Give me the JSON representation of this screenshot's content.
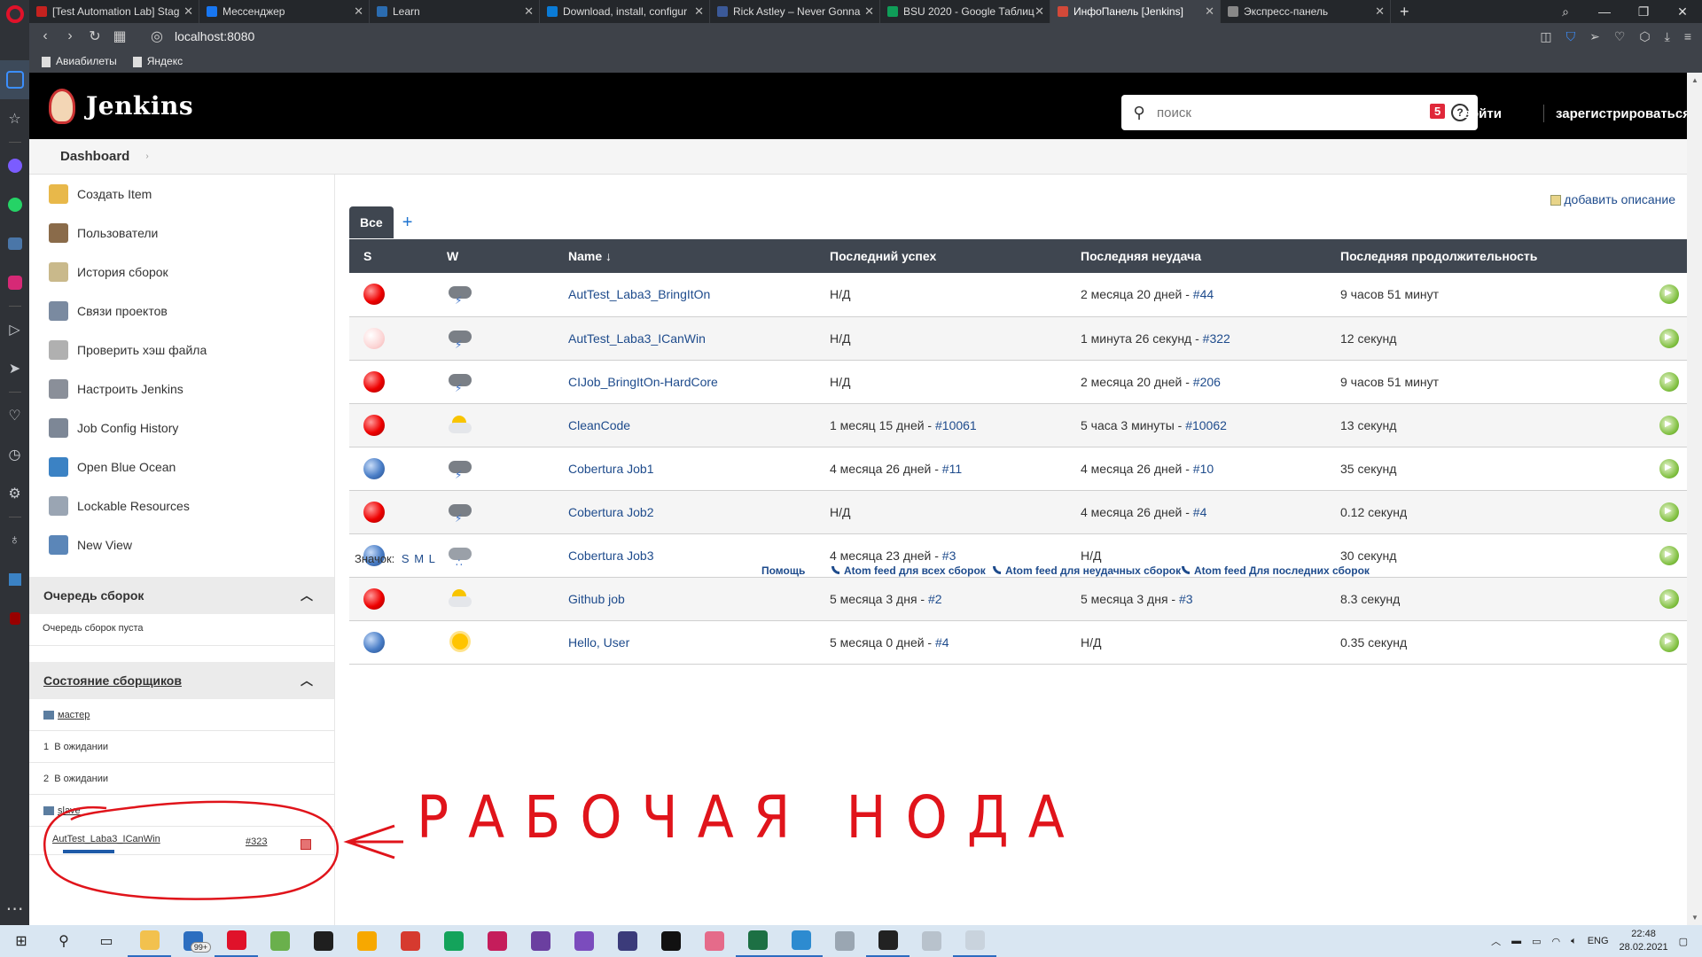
{
  "browser": {
    "tabs": [
      {
        "title": "[Test Automation Lab] Stag",
        "color": "#c5221f"
      },
      {
        "title": "Мессенджер",
        "color": "#1877f2"
      },
      {
        "title": "Learn",
        "color": "#2b6cb0"
      },
      {
        "title": "Download, install, configur",
        "color": "#0a7bd6"
      },
      {
        "title": "Rick Astley – Never Gonna",
        "color": "#3b5998"
      },
      {
        "title": "BSU 2020 - Google Таблиц",
        "color": "#0f9d58"
      },
      {
        "title": "ИнфоПанель [Jenkins]",
        "color": "#d24939"
      },
      {
        "title": "Экспресс-панель",
        "color": "#888888"
      }
    ],
    "active_tab": 6,
    "url": "localhost:8080",
    "bookmarks": [
      "Авиабилеты",
      "Яндекс"
    ]
  },
  "header": {
    "title": "Jenkins",
    "search_placeholder": "поиск",
    "notifications": "5",
    "login": "войти",
    "register": "зарегистрироваться"
  },
  "breadcrumb": {
    "root": "Dashboard"
  },
  "tasks": [
    {
      "label": "Создать Item",
      "icon": "new-item-icon",
      "color": "#e8b84a"
    },
    {
      "label": "Пользователи",
      "icon": "users-icon",
      "color": "#8a6b4a"
    },
    {
      "label": "История сборок",
      "icon": "notepad-icon",
      "color": "#c9b98b"
    },
    {
      "label": "Связи проектов",
      "icon": "search-icon",
      "color": "#7a8aa0"
    },
    {
      "label": "Проверить хэш файла",
      "icon": "fingerprint-icon",
      "color": "#b0b0b0"
    },
    {
      "label": "Настроить Jenkins",
      "icon": "gear-icon",
      "color": "#8a8f99"
    },
    {
      "label": "Job Config History",
      "icon": "tools-icon",
      "color": "#7d8796"
    },
    {
      "label": "Open Blue Ocean",
      "icon": "blue-ocean-icon",
      "color": "#3b82c4"
    },
    {
      "label": "Lockable Resources",
      "icon": "lock-icon",
      "color": "#9aa5b3"
    },
    {
      "label": "New View",
      "icon": "folder-icon",
      "color": "#5b86b8"
    }
  ],
  "build_queue": {
    "title": "Очередь сборок",
    "empty_text": "Очередь сборок пуста"
  },
  "executors": {
    "title": "Состояние сборщиков",
    "master": "мастер",
    "master_rows": [
      {
        "num": "1",
        "status": "В ожидании"
      },
      {
        "num": "2",
        "status": "В ожидании"
      }
    ],
    "slave": "slave",
    "slave_job": "AutTest_Laba3_ICanWin",
    "slave_build": "#323"
  },
  "main": {
    "add_description": "добавить описание",
    "view_tab": "Все",
    "view_add": "+",
    "columns": {
      "s": "S",
      "w": "W",
      "name": "Name ↓",
      "last_success": "Последний успех",
      "last_failure": "Последняя неудача",
      "last_duration": "Последняя продолжительность"
    },
    "jobs": [
      {
        "status": "red",
        "weather": "storm",
        "name": "AutTest_Laba3_BringItOn",
        "ok_text": "Н/Д",
        "ok_link": "",
        "fail_text": "2 месяца 20 дней - ",
        "fail_link": "#44",
        "duration": "9 часов 51 минут"
      },
      {
        "status": "pale",
        "weather": "storm",
        "name": "AutTest_Laba3_ICanWin",
        "ok_text": "Н/Д",
        "ok_link": "",
        "fail_text": "1 минута 26 секунд - ",
        "fail_link": "#322",
        "duration": "12 секунд"
      },
      {
        "status": "red",
        "weather": "storm",
        "name": "CIJob_BringItOn-HardCore",
        "ok_text": "Н/Д",
        "ok_link": "",
        "fail_text": "2 месяца 20 дней - ",
        "fail_link": "#206",
        "duration": "9 часов 51 минут"
      },
      {
        "status": "red",
        "weather": "cloudy",
        "name": "CleanCode",
        "ok_text": "1 месяц 15 дней - ",
        "ok_link": "#10061",
        "fail_text": "5 часа 3 минуты - ",
        "fail_link": "#10062",
        "duration": "13 секунд"
      },
      {
        "status": "blue",
        "weather": "storm",
        "name": "Cobertura Job1",
        "ok_text": "4 месяца 26 дней - ",
        "ok_link": "#11",
        "fail_text": "4 месяца 26 дней - ",
        "fail_link": "#10",
        "duration": "35 секунд"
      },
      {
        "status": "red",
        "weather": "storm",
        "name": "Cobertura Job2",
        "ok_text": "Н/Д",
        "ok_link": "",
        "fail_text": "4 месяца 26 дней - ",
        "fail_link": "#4",
        "duration": "0.12 секунд"
      },
      {
        "status": "blue",
        "weather": "rain",
        "name": "Cobertura Job3",
        "ok_text": "4 месяца 23 дней - ",
        "ok_link": "#3",
        "fail_text": "Н/Д",
        "fail_link": "",
        "duration": "30 секунд"
      },
      {
        "status": "red",
        "weather": "cloudy",
        "name": "Github job",
        "ok_text": "5 месяца 3 дня - ",
        "ok_link": "#2",
        "fail_text": "5 месяца 3 дня - ",
        "fail_link": "#3",
        "duration": "8.3 секунд"
      },
      {
        "status": "blue",
        "weather": "sunny",
        "name": "Hello, User",
        "ok_text": "5 месяца 0 дней - ",
        "ok_link": "#4",
        "fail_text": "Н/Д",
        "fail_link": "",
        "duration": "0.35 секунд"
      }
    ],
    "icon_legend_label": "Значок:",
    "icon_sizes": [
      "S",
      "M",
      "L"
    ],
    "footer_links": {
      "help": "Помощь",
      "atom_all": "Atom feed для всех сборок",
      "atom_failed": "Atom feed для неудачных сборок",
      "atom_latest": "Atom feed Для последних сборок"
    }
  },
  "annotation": {
    "text": "РАБОЧАЯ НОДА",
    "color": "#e0141b"
  },
  "taskbar": {
    "apps": [
      {
        "name": "file-explorer-icon",
        "color": "#f2c14e",
        "running": true
      },
      {
        "name": "mail-icon",
        "color": "#2c6ec0",
        "running": false
      },
      {
        "name": "opera-icon",
        "color": "#e0122a",
        "running": true
      },
      {
        "name": "utorrent-icon",
        "color": "#6ab04c",
        "running": false
      },
      {
        "name": "intellij-icon",
        "color": "#1f1f1f",
        "running": false
      },
      {
        "name": "sourcetree-icon",
        "color": "#f7a800",
        "running": false
      },
      {
        "name": "ccleaner-icon",
        "color": "#d63a2f",
        "running": false
      },
      {
        "name": "skype-icon",
        "color": "#14a35b",
        "running": false
      },
      {
        "name": "rider-icon",
        "color": "#c51d5b",
        "running": false
      },
      {
        "name": "phpstorm-icon",
        "color": "#6b3fa0",
        "running": false
      },
      {
        "name": "visual-studio-icon",
        "color": "#7b4cbd",
        "running": false
      },
      {
        "name": "vs-code-icon",
        "color": "#3b3b7a",
        "running": false
      },
      {
        "name": "netflix-icon",
        "color": "#111111",
        "running": false
      },
      {
        "name": "opera-gx-icon",
        "color": "#e56b8a",
        "running": false
      },
      {
        "name": "excel-icon",
        "color": "#1d7044",
        "running": true
      },
      {
        "name": "telegram-icon",
        "color": "#2d8bd0",
        "running": true
      },
      {
        "name": "photos-icon",
        "color": "#9aa6b2",
        "running": false
      },
      {
        "name": "terminal-icon",
        "color": "#222222",
        "running": true
      },
      {
        "name": "notepad-icon",
        "color": "#b8c2cc",
        "running": false
      },
      {
        "name": "java-icon",
        "color": "#c9d3dd",
        "running": true
      }
    ],
    "mail_badge": "99+",
    "lang": "ENG",
    "time": "22:48",
    "date": "28.02.2021"
  }
}
